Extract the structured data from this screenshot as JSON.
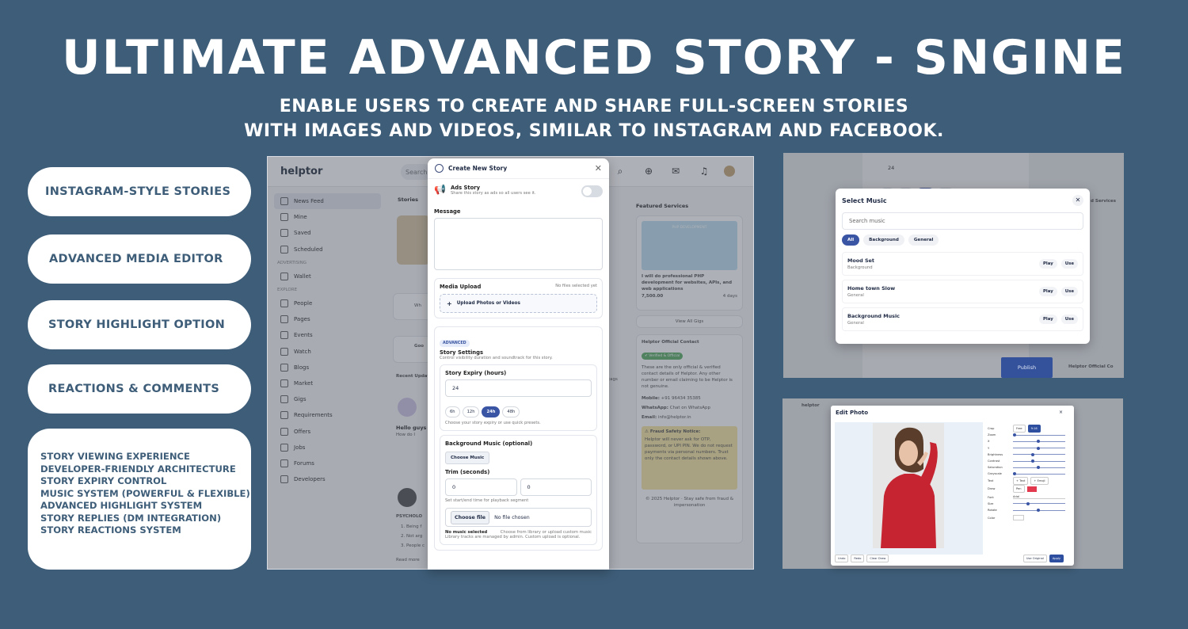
{
  "hero": {
    "title": "ULTIMATE ADVANCED STORY - SNGINE",
    "subtitle_line1": "ENABLE USERS TO CREATE AND SHARE FULL-SCREEN STORIES",
    "subtitle_line2": "WITH IMAGES AND VIDEOS, SIMILAR TO INSTAGRAM AND FACEBOOK."
  },
  "pills": [
    "INSTAGRAM-STYLE STORIES",
    "ADVANCED MEDIA EDITOR",
    "STORY HIGHLIGHT OPTION",
    "REACTIONS & COMMENTS"
  ],
  "features": [
    "STORY VIEWING EXPERIENCE",
    "DEVELOPER-FRIENDLY ARCHITECTURE",
    "STORY EXPIRY CONTROL",
    "MUSIC SYSTEM (POWERFUL & FLEXIBLE)",
    "ADVANCED HIGHLIGHT SYSTEM",
    "STORY REPLIES (DM INTEGRATION)",
    "STORY REACTIONS SYSTEM"
  ],
  "app": {
    "logo": "helptor",
    "search": "Search",
    "sidebar": {
      "items_top": [
        "News Feed",
        "Mine",
        "Saved",
        "Scheduled"
      ],
      "section_advertising": "ADVERTISING",
      "wallet": "Wallet",
      "section_explore": "EXPLORE",
      "explore_items": [
        "People",
        "Pages",
        "Events",
        "Watch",
        "Blogs",
        "Market",
        "Gigs",
        "Requirements",
        "Offers",
        "Jobs",
        "Forums",
        "Developers"
      ]
    },
    "middle": {
      "stories": "Stories",
      "whats_placeholder": "Wh",
      "goo": "Goo",
      "recent_updates": "Recent Updat",
      "post1_user": "G",
      "post1_text1": "Hello guys",
      "post1_text2": "How do I",
      "post2_title": "PSYCHOLO",
      "post2_items": [
        "1. Being f",
        "2. Not arg",
        "3. People c"
      ],
      "read_more": "Read more"
    },
    "right": {
      "featured_services": "Featured Services",
      "gig_banner": "PHP DEVELOPMENT",
      "gig_title": "I will do professional PHP development for websites, APIs, and web applications",
      "gig_price": "7,500.00",
      "gig_days": "4 days",
      "view_all": "View All Gigs",
      "contact_title": "Helptor Official Contact",
      "verified": "✔ Verified & Official",
      "contact_text": "These are the only official & verified contact details of Helptor. Any other number or email claiming to be Helptor is not genuine.",
      "mobile_label": "Mobile:",
      "mobile": "+91 96434 35385",
      "whatsapp_label": "WhatsApp:",
      "whatsapp": "Chat on WhatsApp",
      "email_label": "Email:",
      "email": "info@helptor.in",
      "fraud_title": "⚠ Fraud Safety Notice:",
      "fraud_text": "Helptor will never ask for OTP, password, or UPI PIN. We do not request payments via personal numbers. Trust only the contact details shown above.",
      "footer": "© 2025 Helptor · Stay safe from fraud & impersonation",
      "ags": "tags"
    }
  },
  "modal": {
    "title": "Create New Story",
    "ads_label": "Ads Story",
    "ads_help": "Share this story as ads so all users see it.",
    "message_label": "Message",
    "media_label": "Media Upload",
    "no_files": "No files selected yet",
    "upload_btn": "Upload Photos or Videos",
    "advanced_badge": "ADVANCED",
    "story_settings": "Story Settings",
    "story_settings_help": "Control visibility duration and soundtrack for this story.",
    "expiry_label": "Story Expiry (hours)",
    "expiry_value": "24",
    "expiry_chips": [
      "6h",
      "12h",
      "24h",
      "48h"
    ],
    "expiry_help": "Choose your story expiry or use quick presets.",
    "music_label": "Background Music (optional)",
    "choose_music": "Choose Music",
    "trim_label": "Trim (seconds)",
    "trim_start": "0",
    "trim_end": "0",
    "trim_help": "Set start/end time for playback segment",
    "choose_file": "Choose file",
    "no_file": "No file chosen",
    "no_music": "No music selected",
    "music_help": "Choose from library or upload custom music",
    "library_help": "Library tracks are managed by admin. Custom upload is optional."
  },
  "music": {
    "bg_value": "24",
    "bg_chips": [
      "6h",
      "12h",
      "24h",
      "48h"
    ],
    "bg_services": "d Services",
    "title": "Select Music",
    "search_placeholder": "Search music",
    "chips": [
      "All",
      "Background",
      "General"
    ],
    "tracks": [
      {
        "name": "Mood Set",
        "cat": "Background"
      },
      {
        "name": "Home town Slow",
        "cat": "General"
      },
      {
        "name": "Background Music",
        "cat": "General"
      }
    ],
    "play": "Play",
    "use": "Use",
    "publish": "Publish",
    "official": "Helptor Official Co"
  },
  "editor": {
    "logo": "helptor",
    "title": "Edit Photo",
    "close": "×",
    "controls": [
      "Crop",
      "Zoom",
      "X",
      "Y",
      "Brightness",
      "Contrast",
      "Saturation",
      "Grayscale",
      "Text",
      "Draw",
      "Font",
      "Size",
      "Rotate",
      "Color"
    ],
    "crop_free": "Free",
    "crop_916": "9:16",
    "text_btn": "+ Text",
    "emoji_btn": "+ Emoji",
    "draw_pen": "Pen",
    "font_value": "Arial",
    "footer_undo": "Undo",
    "footer_redo": "Redo",
    "footer_clear": "Clear Draw",
    "footer_original": "Use Original",
    "footer_apply": "Apply"
  }
}
